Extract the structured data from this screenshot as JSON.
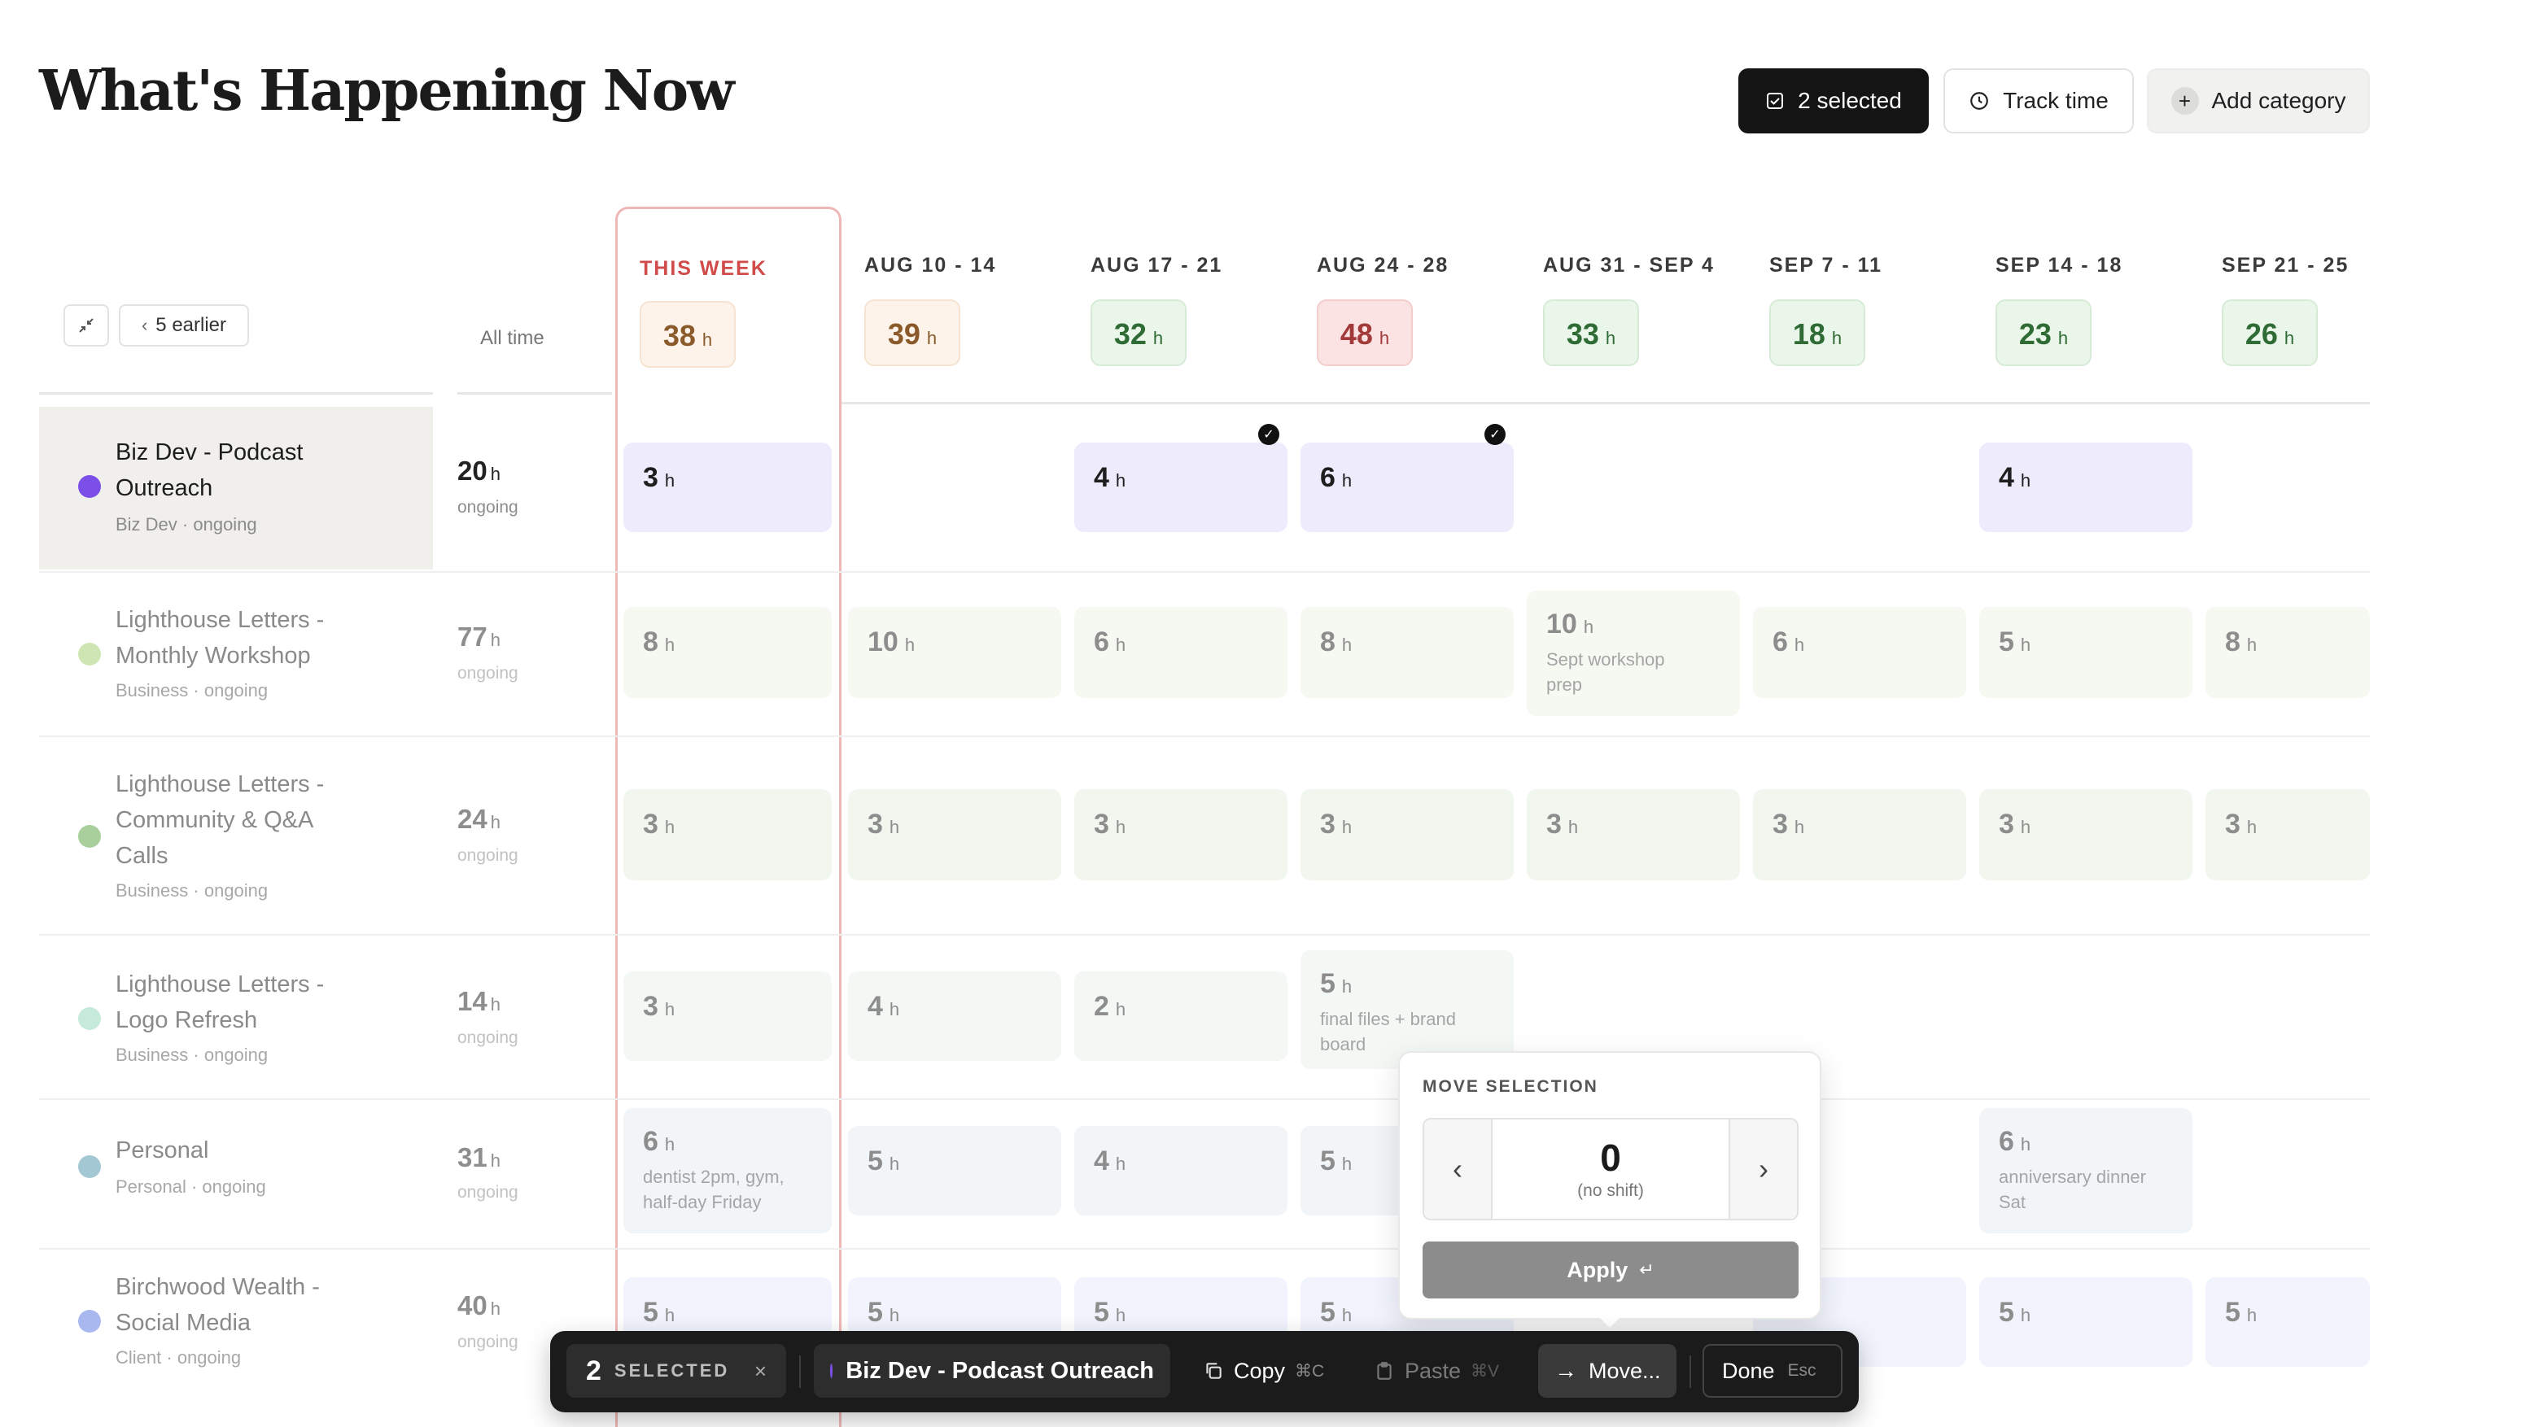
{
  "header": {
    "title": "What's Happening Now",
    "selected_label": "2 selected",
    "track_time_label": "Track time",
    "add_category_label": "Add category"
  },
  "nav": {
    "earlier_label": "5 earlier",
    "all_time_label": "All time"
  },
  "weeks": [
    {
      "label": "THIS WEEK",
      "total": "38",
      "unit": "h"
    },
    {
      "label": "AUG 10 - 14",
      "total": "39",
      "unit": "h"
    },
    {
      "label": "AUG 17 - 21",
      "total": "32",
      "unit": "h"
    },
    {
      "label": "AUG 24 - 28",
      "total": "48",
      "unit": "h"
    },
    {
      "label": "AUG 31 - SEP 4",
      "total": "33",
      "unit": "h"
    },
    {
      "label": "SEP 7 - 11",
      "total": "18",
      "unit": "h"
    },
    {
      "label": "SEP 14 - 18",
      "total": "23",
      "unit": "h"
    },
    {
      "label": "SEP 21 - 25",
      "total": "26",
      "unit": "h"
    }
  ],
  "rows": [
    {
      "name_line1": "Biz Dev - Podcast",
      "name_line2": "Outreach",
      "name_line3": "",
      "category": "Biz Dev",
      "status": "ongoing",
      "all_time": "20",
      "unit": "h",
      "dot_color": "#7b4fe8"
    },
    {
      "name_line1": "Lighthouse Letters -",
      "name_line2": "Monthly Workshop",
      "name_line3": "",
      "category": "Business",
      "status": "ongoing",
      "all_time": "77",
      "unit": "h",
      "dot_color": "#cde6b4"
    },
    {
      "name_line1": "Lighthouse Letters -",
      "name_line2": "Community & Q&A",
      "name_line3": "Calls",
      "category": "Business",
      "status": "ongoing",
      "all_time": "24",
      "unit": "h",
      "dot_color": "#a9cf9c"
    },
    {
      "name_line1": "Lighthouse Letters -",
      "name_line2": "Logo Refresh",
      "name_line3": "",
      "category": "Business",
      "status": "ongoing",
      "all_time": "14",
      "unit": "h",
      "dot_color": "#c5ead9"
    },
    {
      "name_line1": "Personal",
      "name_line2": "",
      "name_line3": "",
      "category": "Personal",
      "status": "ongoing",
      "all_time": "31",
      "unit": "h",
      "dot_color": "#a3c8d3"
    },
    {
      "name_line1": "Birchwood Wealth -",
      "name_line2": "Social Media",
      "name_line3": "",
      "category": "Client",
      "status": "ongoing",
      "all_time": "40",
      "unit": "h",
      "dot_color": "#a9b9f0"
    }
  ],
  "cells": {
    "r0": [
      "3",
      "4",
      "6",
      "4"
    ],
    "r1": [
      "8",
      "10",
      "6",
      "8",
      "10",
      "6",
      "5",
      "8"
    ],
    "r1_note": "Sept workshop prep",
    "r2": [
      "3",
      "3",
      "3",
      "3",
      "3",
      "3",
      "3",
      "3"
    ],
    "r3": [
      "3",
      "4",
      "2",
      "5"
    ],
    "r3_note": "final files + brand board",
    "r4": [
      "6",
      "5",
      "4",
      "5",
      "6"
    ],
    "r4_note_1": "dentist 2pm, gym, half-day Friday",
    "r4_note_2": "anniversary dinner Sat",
    "r5": [
      "5",
      "5",
      "5",
      "5",
      "5",
      "5"
    ]
  },
  "popover": {
    "title": "MOVE SELECTION",
    "value": "0",
    "hint": "(no shift)",
    "apply_label": "Apply",
    "enter_glyph": "↵"
  },
  "action_bar": {
    "count": "2",
    "selected_label": "SELECTED",
    "project": "Biz Dev - Podcast Outreach",
    "copy_label": "Copy",
    "copy_key": "⌘C",
    "paste_label": "Paste",
    "paste_key": "⌘V",
    "move_label": "Move...",
    "done_label": "Done",
    "done_key": "Esc"
  },
  "colors": {
    "accent_purple": "#7b4fe8",
    "this_week_red": "#d14b4b",
    "selected_cell_bg": "#eeebfd"
  }
}
